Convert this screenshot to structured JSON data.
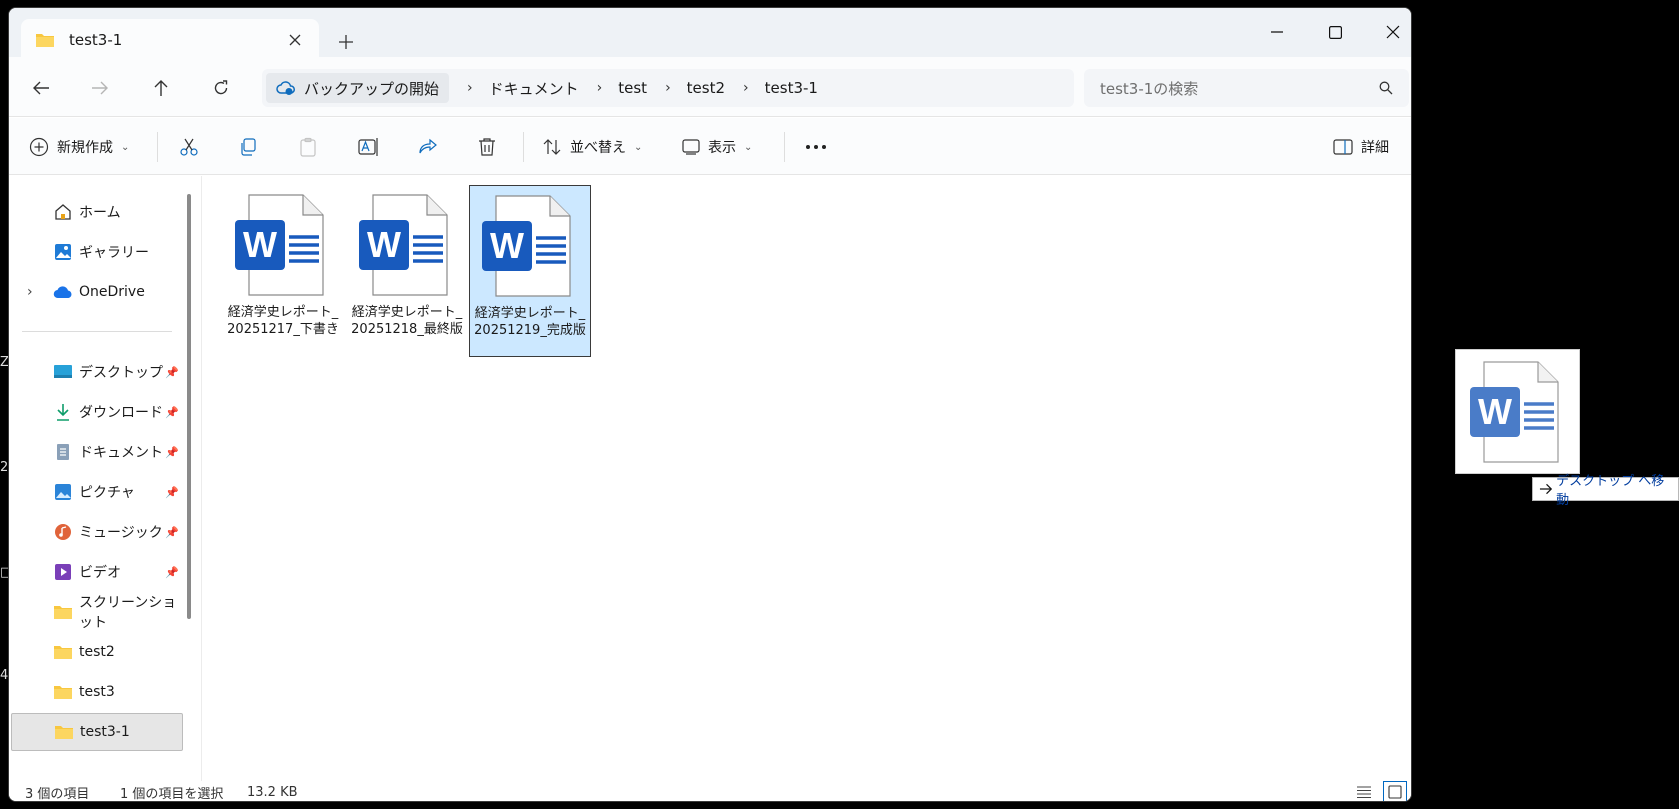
{
  "window": {
    "tab_title": "test3-1"
  },
  "nav": {
    "breadcrumbs": [
      "バックアップの開始",
      "ドキュメント",
      "test",
      "test2",
      "test3-1"
    ],
    "search_placeholder": "test3-1の検索"
  },
  "toolbar": {
    "new_label": "新規作成",
    "sort_label": "並べ替え",
    "view_label": "表示",
    "details_label": "詳細"
  },
  "sidebar": {
    "items": [
      {
        "label": "ホーム",
        "icon": "home-icon"
      },
      {
        "label": "ギャラリー",
        "icon": "gallery-icon"
      },
      {
        "label": "OneDrive",
        "icon": "onedrive-icon"
      },
      {
        "label": "デスクトップ",
        "icon": "desktop-icon"
      },
      {
        "label": "ダウンロード",
        "icon": "download-icon"
      },
      {
        "label": "ドキュメント",
        "icon": "documents-icon"
      },
      {
        "label": "ピクチャ",
        "icon": "pictures-icon"
      },
      {
        "label": "ミュージック",
        "icon": "music-icon"
      },
      {
        "label": "ビデオ",
        "icon": "video-icon"
      },
      {
        "label": "スクリーンショット",
        "icon": "folder-icon"
      },
      {
        "label": "test2",
        "icon": "folder-icon"
      },
      {
        "label": "test3",
        "icon": "folder-icon"
      },
      {
        "label": "test3-1",
        "icon": "folder-icon"
      }
    ]
  },
  "files": [
    {
      "name": "経済学史レポート_20251217_下書き",
      "selected": false
    },
    {
      "name": "経済学史レポート_20251218_最終版",
      "selected": false
    },
    {
      "name": "経済学史レポート_20251219_完成版",
      "selected": true
    }
  ],
  "status": {
    "count": "3 個の項目",
    "selection": "1 個の項目を選択",
    "size": "13.2 KB"
  },
  "drag": {
    "tooltip": "デスクトップ へ移動"
  },
  "colors": {
    "word_blue": "#185abd",
    "selection_bg": "#cce8ff",
    "folder_yellow": "#f8c73f",
    "accent": "#0067c0"
  }
}
